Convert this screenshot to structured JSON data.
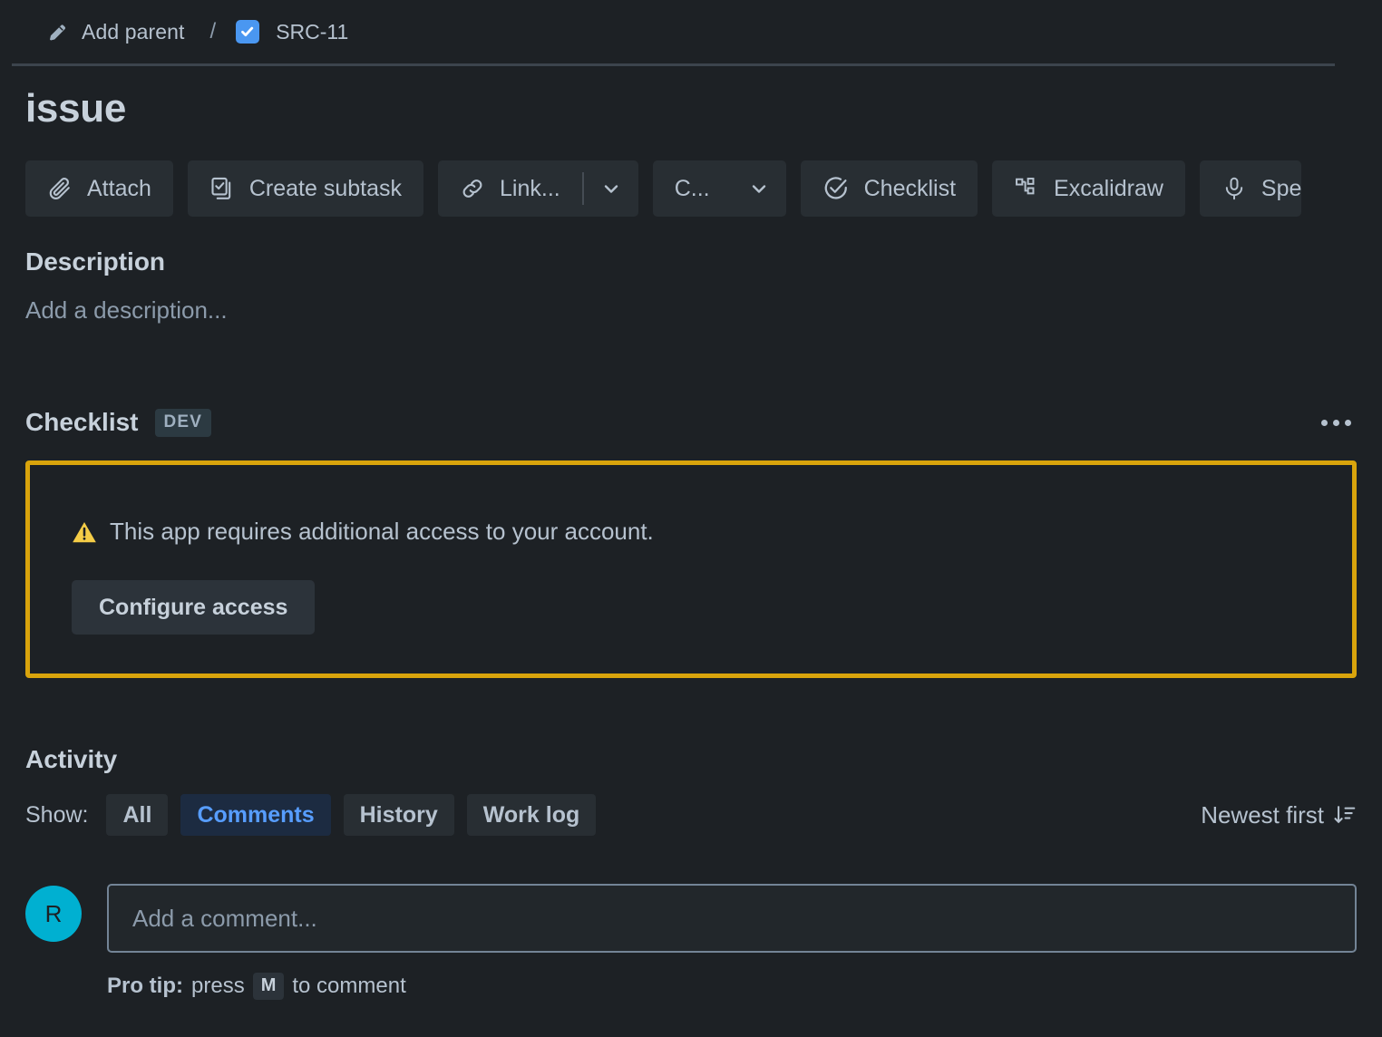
{
  "breadcrumb": {
    "parent_label": "Add parent",
    "parent_icon": "pencil-icon",
    "separator": "/",
    "issue_key": "SRC-11",
    "issue_icon": "task-checkbox-icon"
  },
  "issue": {
    "title": "issue"
  },
  "toolbar": {
    "buttons": [
      {
        "label": "Attach",
        "icon": "paperclip-icon"
      },
      {
        "label": "Create subtask",
        "icon": "subtask-icon"
      },
      {
        "label": "Link...",
        "icon": "link-icon",
        "has_caret": true
      },
      {
        "label": "C...",
        "icon": "none",
        "has_caret": true
      },
      {
        "label": "Checklist",
        "icon": "check-circle-icon"
      },
      {
        "label": "Excalidraw",
        "icon": "excalidraw-icon"
      },
      {
        "label": "Spe",
        "icon": "microphone-icon",
        "clipped": true
      }
    ]
  },
  "description": {
    "heading": "Description",
    "placeholder": "Add a description..."
  },
  "checklist": {
    "heading": "Checklist",
    "badge": "DEV",
    "more_label": "More actions",
    "access": {
      "warning_icon": "warning-triangle-icon",
      "message": "This app requires additional access to your account.",
      "button_label": "Configure access",
      "border_color": "#d9a40c"
    }
  },
  "activity": {
    "heading": "Activity",
    "show_label": "Show:",
    "filters": [
      {
        "label": "All",
        "active": false
      },
      {
        "label": "Comments",
        "active": true
      },
      {
        "label": "History",
        "active": false
      },
      {
        "label": "Work log",
        "active": false
      }
    ],
    "sort_label": "Newest first",
    "sort_icon": "sort-descending-icon",
    "accent_color": "#579dff"
  },
  "comment": {
    "avatar_initial": "R",
    "avatar_color": "#00b0d1",
    "placeholder": "Add a comment...",
    "value": "",
    "pro_tip_prefix": "Pro tip:",
    "pro_tip_text": "press",
    "pro_tip_key": "M",
    "pro_tip_suffix": "to comment"
  }
}
